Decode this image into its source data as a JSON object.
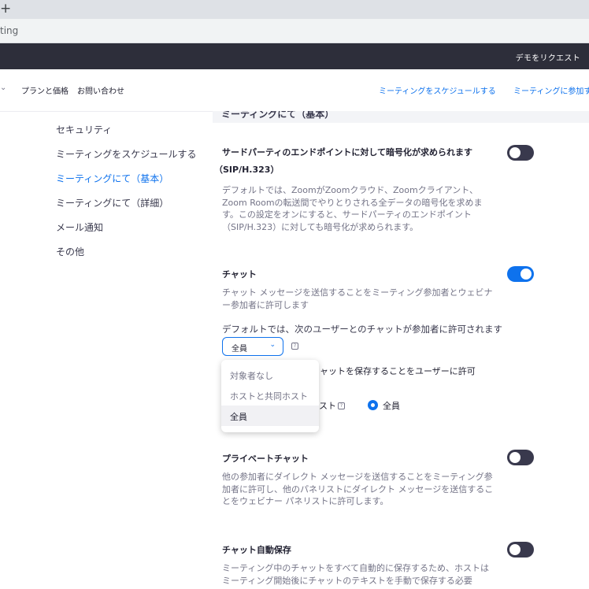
{
  "browser": {
    "new_tab_label": "+",
    "address_fragment": "ting"
  },
  "header": {
    "demo_request": "デモをリクエスト"
  },
  "nav": {
    "caret": "⌄",
    "pricing": "プランと価格",
    "contact": "お問い合わせ",
    "schedule_meeting": "ミーティングをスケジュールする",
    "join_meeting": "ミーティングに参加す"
  },
  "sidebar": {
    "items": [
      {
        "label": "セキュリティ",
        "active": false
      },
      {
        "label": "ミーティングをスケジュールする",
        "active": false
      },
      {
        "label": "ミーティングにて（基本）",
        "active": true
      },
      {
        "label": "ミーティングにて（詳細）",
        "active": false
      },
      {
        "label": "メール通知",
        "active": false
      },
      {
        "label": "その他",
        "active": false
      }
    ]
  },
  "content": {
    "section_header": "ミーティングにて（基本）",
    "settings": {
      "encryption": {
        "title_line1": "サードパーティのエンドポイントに対して暗号化が求められます",
        "title_line2": "（SIP/H.323）",
        "description": "デフォルトでは、ZoomがZoomクラウド、Zoomクライアント、Zoom Roomの転送間でやりとりされる全データの暗号化を求めます。この設定をオンにすると、サードパーティのエンドポイント（SIP/H.323）に対しても暗号化が求められます。",
        "enabled": false
      },
      "chat": {
        "title": "チャット",
        "description": "チャット メッセージを送信することをミーティング参加者とウェビナー参加者に許可します",
        "default_label": "デフォルトでは、次のユーザーとのチャットが参加者に許可されます",
        "select_value": "全員",
        "save_label_partial": "ャットを保存することをユーザーに許可",
        "panelist_partial": "スト",
        "radio_label": "全員",
        "enabled": true,
        "dropdown_options": [
          {
            "label": "対象者なし",
            "selected": false
          },
          {
            "label": "ホストと共同ホスト",
            "selected": false
          },
          {
            "label": "全員",
            "selected": true
          }
        ]
      },
      "private_chat": {
        "title": "プライベートチャット",
        "description": "他の参加者にダイレクト メッセージを送信することをミーティング参加者に許可し、他のパネリストにダイレクト メッセージを送信することをウェビナー パネリストに許可します。",
        "enabled": false
      },
      "auto_save": {
        "title": "チャット自動保存",
        "description": "ミーティング中のチャットをすべて自動的に保存するため、ホストはミーティング開始後にチャットのテキストを手動で保存する必要",
        "enabled": false
      }
    }
  },
  "colors": {
    "accent": "#0e72ed",
    "toggle_off": "#39394d",
    "header_bg": "#2d2e3a"
  }
}
